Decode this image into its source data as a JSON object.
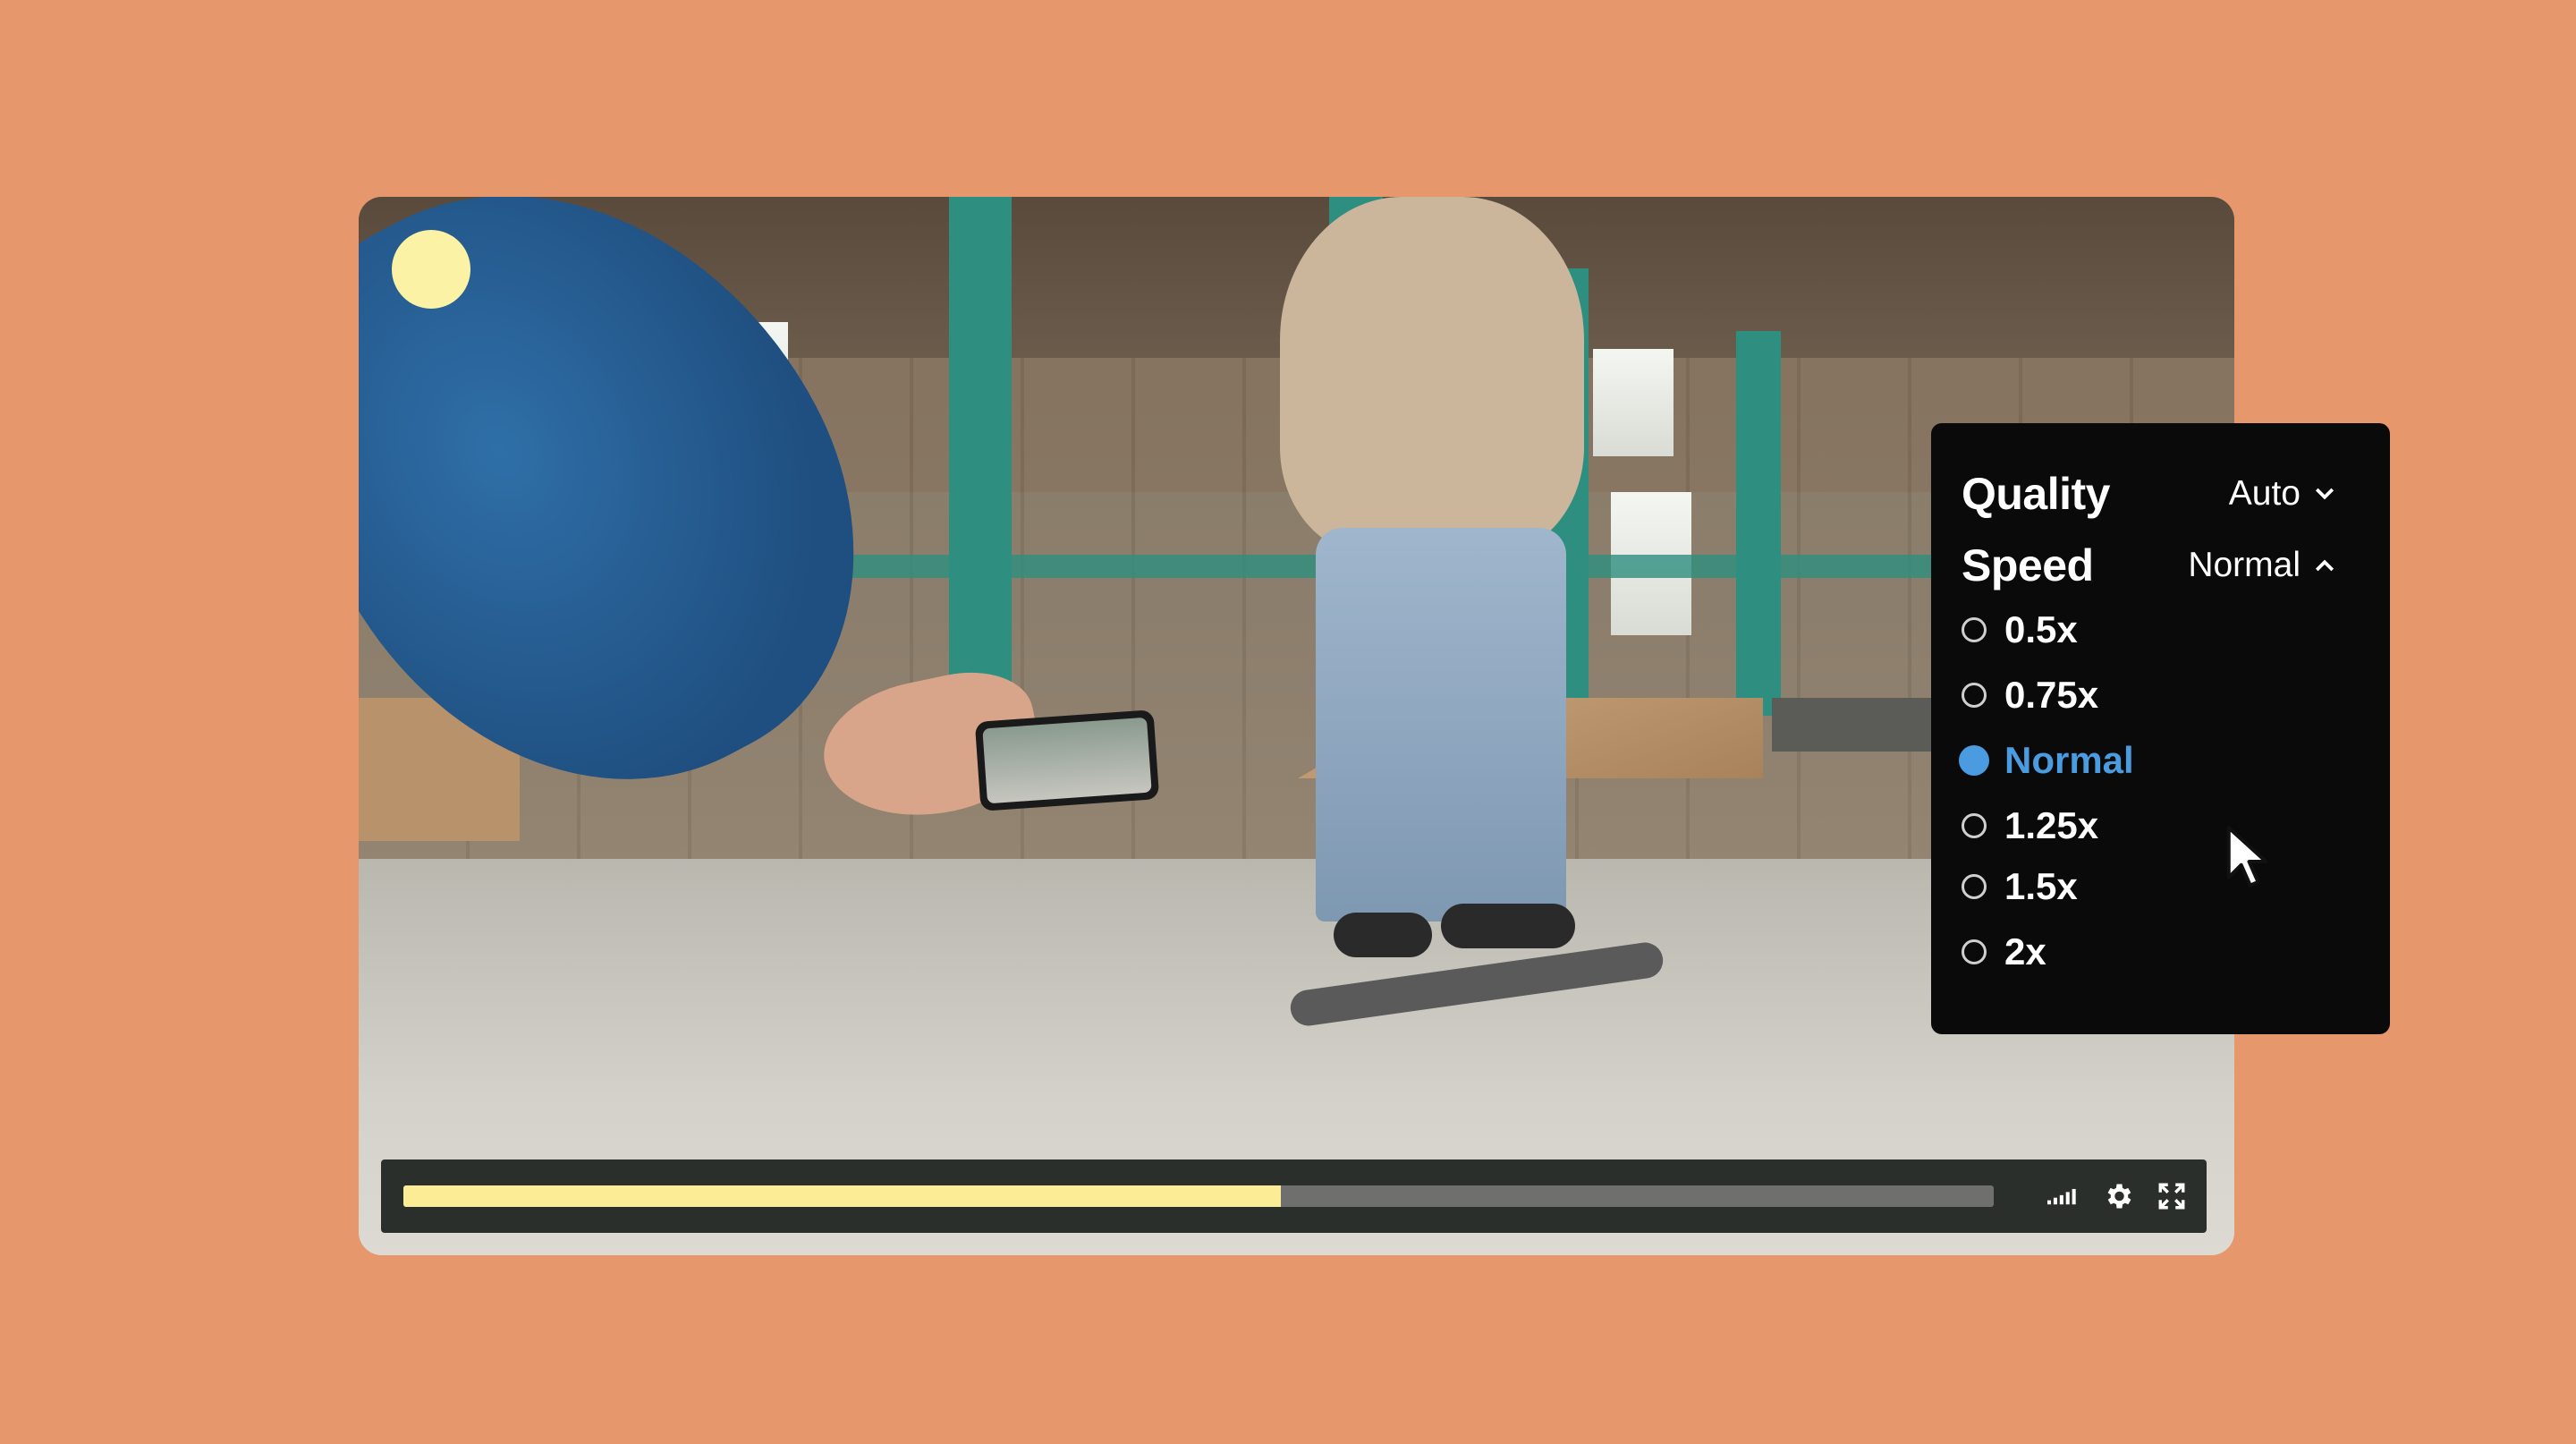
{
  "player": {
    "progress_fraction": 0.552,
    "controls": {
      "signal_icon": "signal-bars-icon",
      "settings_icon": "gear-icon",
      "fullscreen_icon": "fullscreen-icon"
    }
  },
  "settings_menu": {
    "quality": {
      "label": "Quality",
      "value": "Auto"
    },
    "speed": {
      "label": "Speed",
      "value": "Normal"
    },
    "speed_options": [
      {
        "label": "0.5x",
        "selected": false
      },
      {
        "label": "0.75x",
        "selected": false
      },
      {
        "label": "Normal",
        "selected": true
      },
      {
        "label": "1.25x",
        "selected": false
      },
      {
        "label": "1.5x",
        "selected": false
      },
      {
        "label": "2x",
        "selected": false
      }
    ]
  },
  "colors": {
    "background": "#E6976B",
    "accent": "#4A9BE0",
    "progress": "#FCEC95",
    "record_dot": "#FCF2A6"
  }
}
